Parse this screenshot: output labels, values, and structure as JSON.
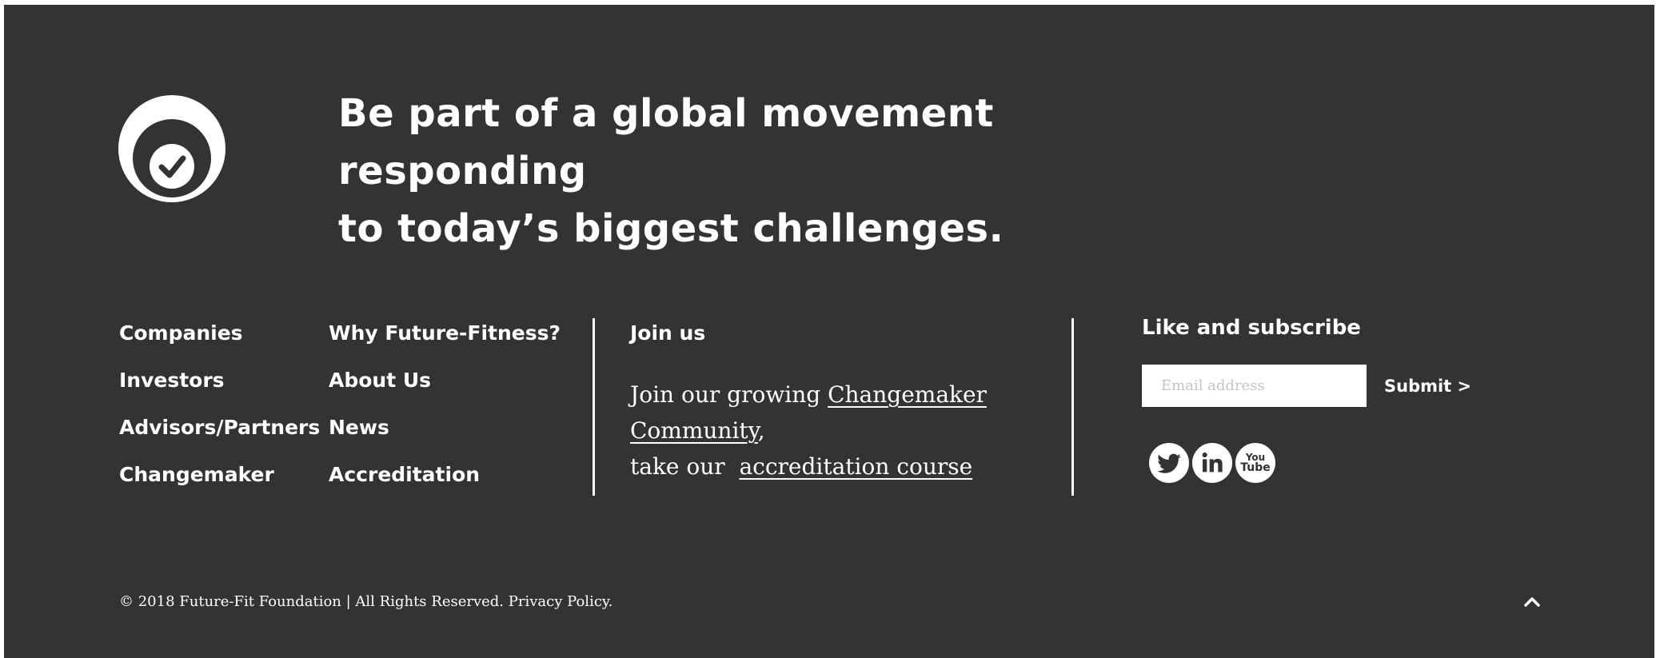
{
  "hero": {
    "logo_icon": "check-circle-icon",
    "headline": "Be part of a global movement responding\nto today’s biggest challenges."
  },
  "nav": {
    "column_1": [
      "Companies",
      "Investors",
      "Advisors/Partners",
      "Changemaker"
    ],
    "column_2": [
      "Why Future-Fitness?",
      "About Us",
      "News",
      "Accreditation"
    ]
  },
  "join": {
    "heading": "Join us",
    "text_1": "Join our growing ",
    "link_1": "Changemaker Community",
    "text_2": ",",
    "text_3": "take our  ",
    "link_2": "accreditation course"
  },
  "subscribe": {
    "heading": "Like and subscribe",
    "email_placeholder": "Email address",
    "submit_label": "Submit >",
    "social": [
      "twitter-icon",
      "linkedin-icon",
      "youtube-icon"
    ],
    "youtube_text_top": "You",
    "youtube_text_bottom": "Tube"
  },
  "footer": {
    "copyright": "© 2018 Future-Fit Foundation | All Rights Reserved. Privacy Policy.",
    "back_to_top_icon": "chevron-up-icon"
  },
  "colors": {
    "background": "#333333",
    "text": "#ffffff",
    "page": "#ffffff"
  }
}
